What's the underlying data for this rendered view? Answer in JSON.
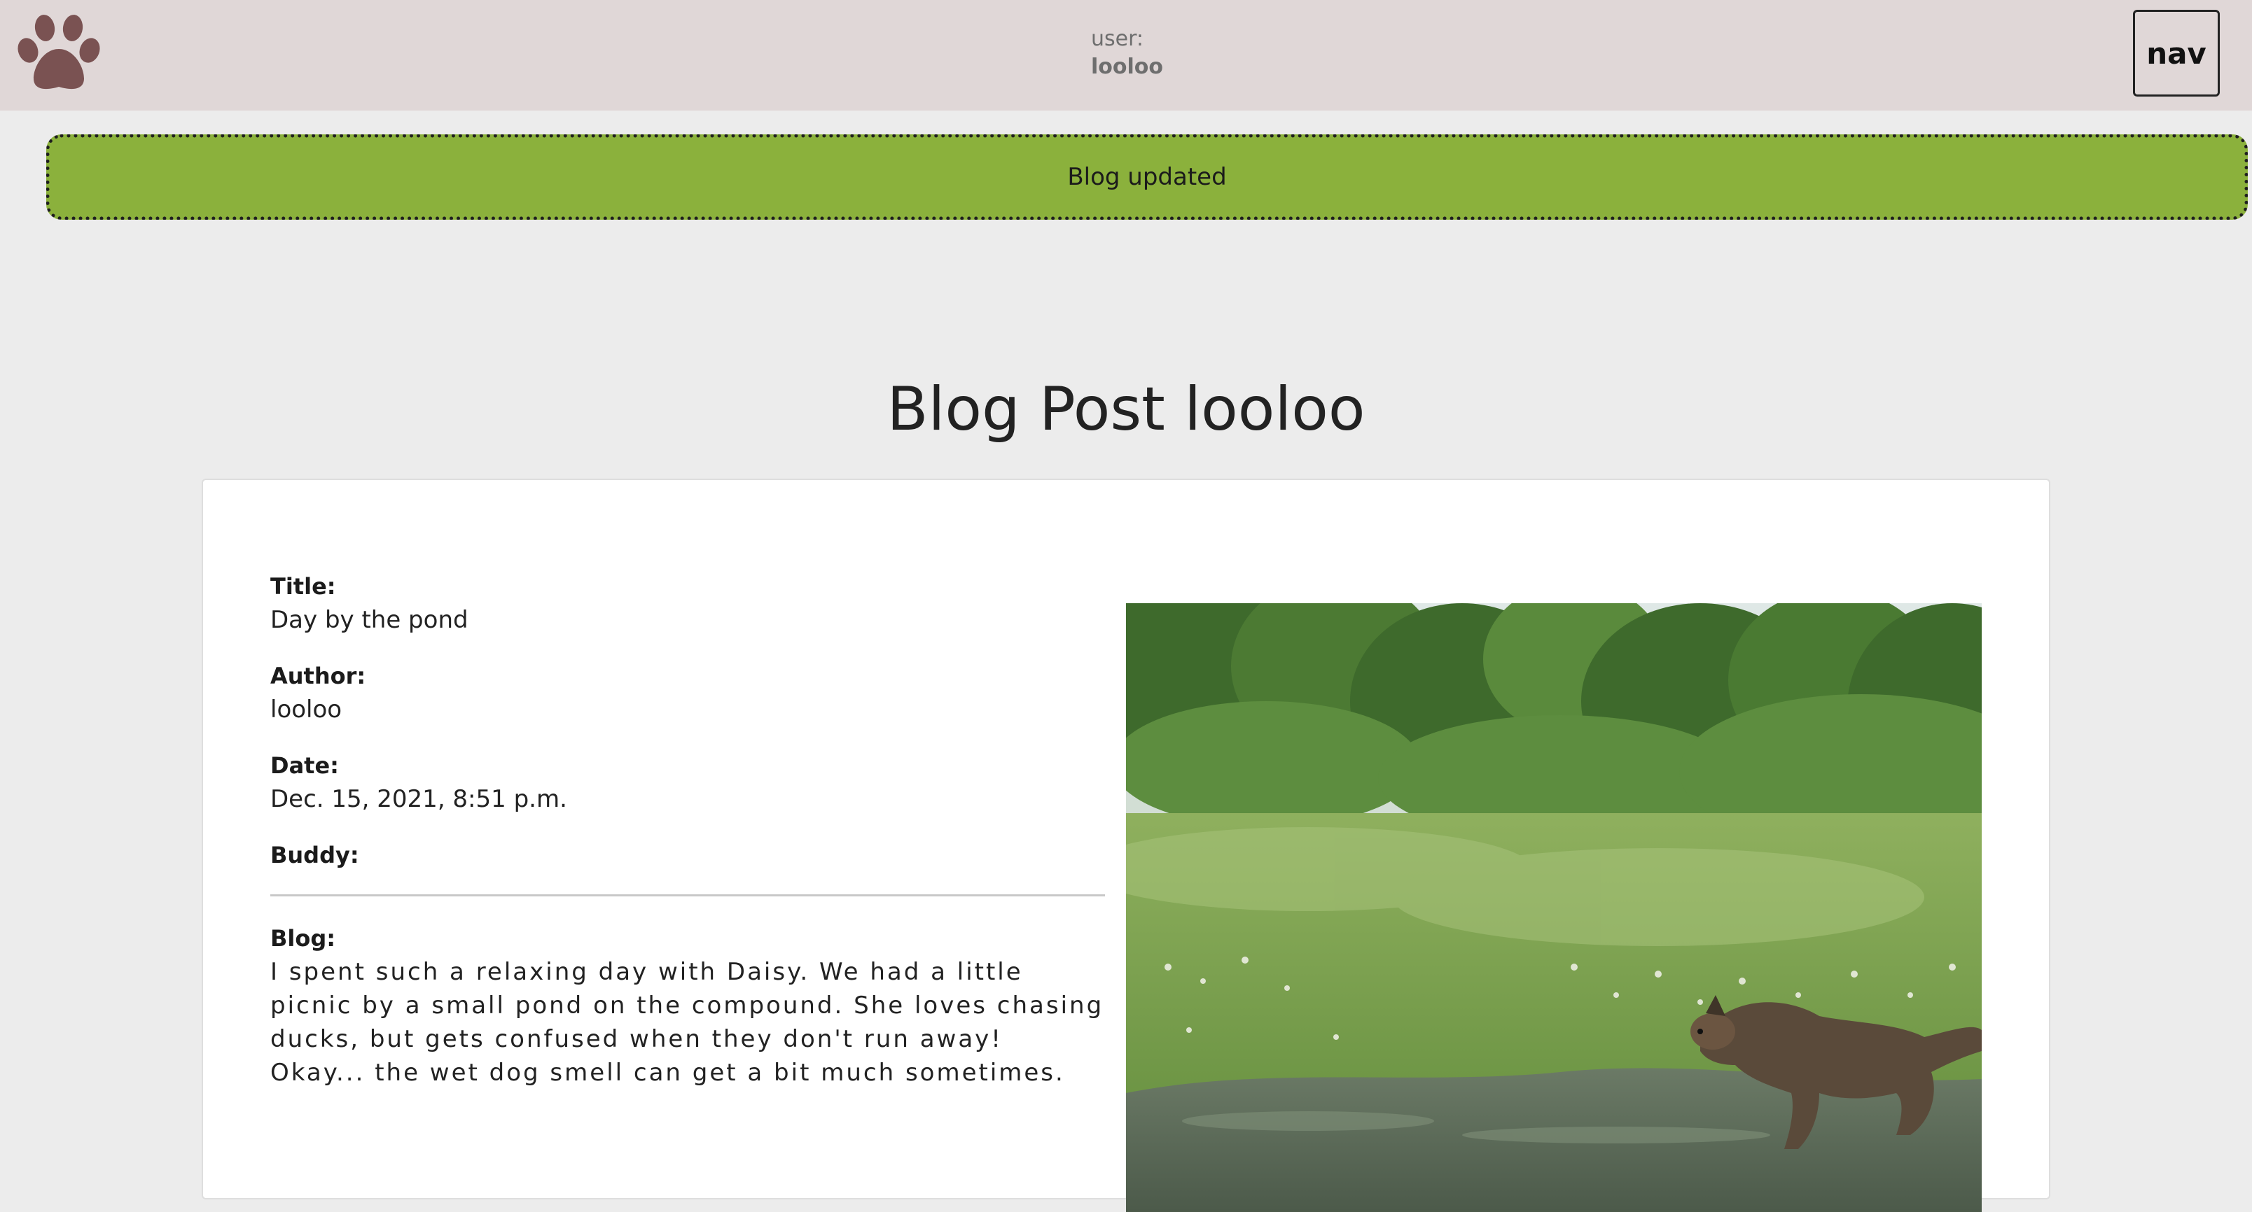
{
  "header": {
    "user_label": "user:",
    "user_name": "looloo",
    "nav_label": "nav",
    "logo_icon": "paw-icon"
  },
  "alert": {
    "message": "Blog updated"
  },
  "page": {
    "title": "Blog Post looloo"
  },
  "post": {
    "title_label": "Title:",
    "title_value": "Day by the pond",
    "author_label": "Author:",
    "author_value": "looloo",
    "date_label": "Date:",
    "date_value": "Dec. 15, 2021, 8:51 p.m.",
    "buddy_label": "Buddy:",
    "buddy_value": "",
    "blog_label": "Blog:",
    "blog_text": "I spent such a relaxing day with Daisy. We had a little picnic by a small pond on the compound. She loves chasing ducks, but gets confused when they don't run away! Okay... the wet dog smell can get a bit much sometimes."
  },
  "colors": {
    "topbar": "#e0d7d7",
    "page_background": "#ececec",
    "alert_success": "#8bb13c",
    "paw": "#7a5252"
  }
}
